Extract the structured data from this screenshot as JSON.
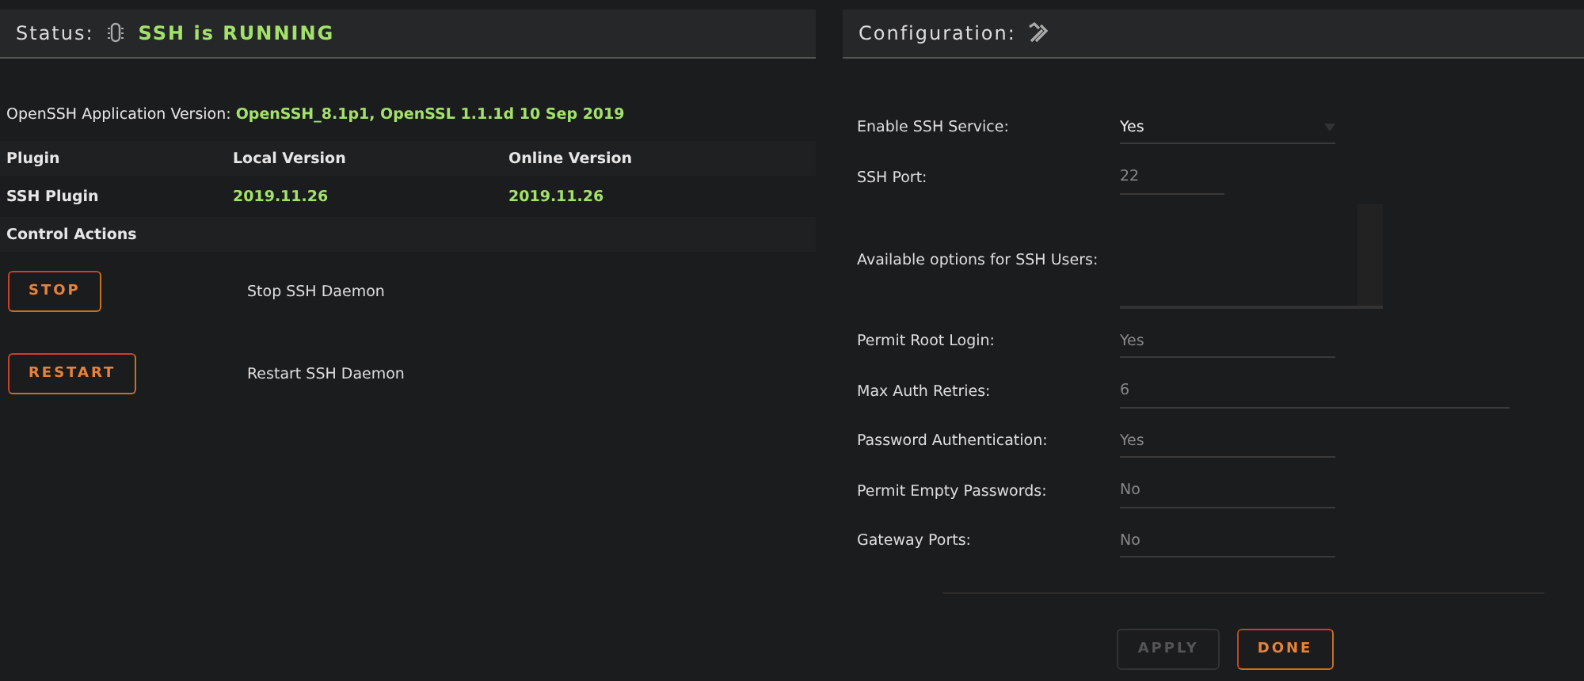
{
  "status": {
    "label": "Status:",
    "value": "SSH is RUNNING",
    "running": true
  },
  "version": {
    "label": "OpenSSH Application Version:",
    "value": "OpenSSH_8.1p1, OpenSSL 1.1.1d 10 Sep 2019"
  },
  "plugins": {
    "columns": [
      "Plugin",
      "Local Version",
      "Online Version"
    ],
    "rows": [
      [
        "SSH Plugin",
        "2019.11.26",
        "2019.11.26"
      ]
    ]
  },
  "control_actions": {
    "title": "Control Actions",
    "actions": [
      {
        "button": "STOP",
        "description": "Stop SSH Daemon"
      },
      {
        "button": "RESTART",
        "description": "Restart SSH Daemon"
      }
    ]
  },
  "configuration": {
    "title": "Configuration:",
    "fields": [
      {
        "label": "Enable SSH Service:",
        "kind": "select",
        "value": "Yes",
        "disabled": false
      },
      {
        "label": "SSH Port:",
        "kind": "port",
        "value": "22",
        "disabled": true
      },
      {
        "label": "Available options for SSH Users:",
        "kind": "textarea"
      },
      {
        "label": "Permit Root Login:",
        "kind": "select",
        "value": "Yes",
        "disabled": true
      },
      {
        "label": "Max Auth Retries:",
        "kind": "number",
        "value": "6",
        "disabled": true
      },
      {
        "label": "Password Authentication:",
        "kind": "select",
        "value": "Yes",
        "disabled": true
      },
      {
        "label": "Permit Empty Passwords:",
        "kind": "select",
        "value": "No",
        "disabled": true
      },
      {
        "label": "Gateway Ports:",
        "kind": "select",
        "value": "No",
        "disabled": true
      }
    ],
    "buttons": [
      {
        "label": "APPLY",
        "disabled": true
      },
      {
        "label": "DONE",
        "disabled": false
      }
    ]
  }
}
